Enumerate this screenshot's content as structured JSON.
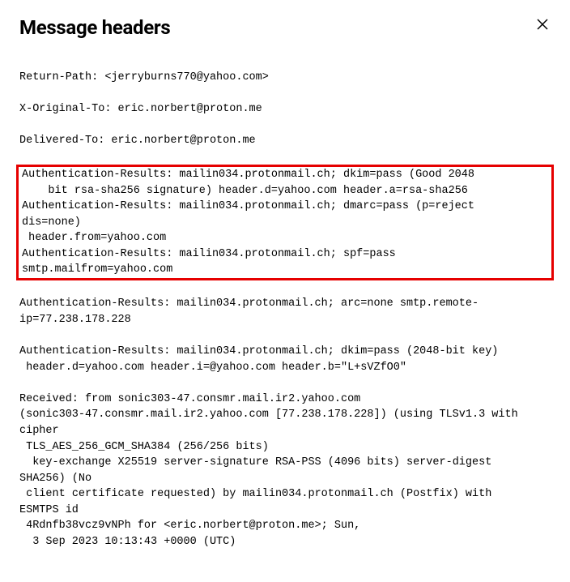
{
  "title": "Message headers",
  "headers": {
    "return_path": "Return-Path: <jerryburns770@yahoo.com>",
    "x_original_to": "X-Original-To: eric.norbert@proton.me",
    "delivered_to": "Delivered-To: eric.norbert@proton.me",
    "highlighted": "Authentication-Results: mailin034.protonmail.ch; dkim=pass (Good 2048\n    bit rsa-sha256 signature) header.d=yahoo.com header.a=rsa-sha256\nAuthentication-Results: mailin034.protonmail.ch; dmarc=pass (p=reject\ndis=none)\n header.from=yahoo.com\nAuthentication-Results: mailin034.protonmail.ch; spf=pass\nsmtp.mailfrom=yahoo.com",
    "auth_arc": "Authentication-Results: mailin034.protonmail.ch; arc=none smtp.remote-\nip=77.238.178.228",
    "auth_dkim2": "Authentication-Results: mailin034.protonmail.ch; dkim=pass (2048-bit key)\n header.d=yahoo.com header.i=@yahoo.com header.b=\"L+sVZfO0\"",
    "received": "Received: from sonic303-47.consmr.mail.ir2.yahoo.com\n(sonic303-47.consmr.mail.ir2.yahoo.com [77.238.178.228]) (using TLSv1.3 with\ncipher\n TLS_AES_256_GCM_SHA384 (256/256 bits)\n  key-exchange X25519 server-signature RSA-PSS (4096 bits) server-digest\nSHA256) (No\n client certificate requested) by mailin034.protonmail.ch (Postfix) with\nESMTPS id\n 4Rdnfb38vcz9vNPh for <eric.norbert@proton.me>; Sun,\n  3 Sep 2023 10:13:43 +0000 (UTC)"
  }
}
